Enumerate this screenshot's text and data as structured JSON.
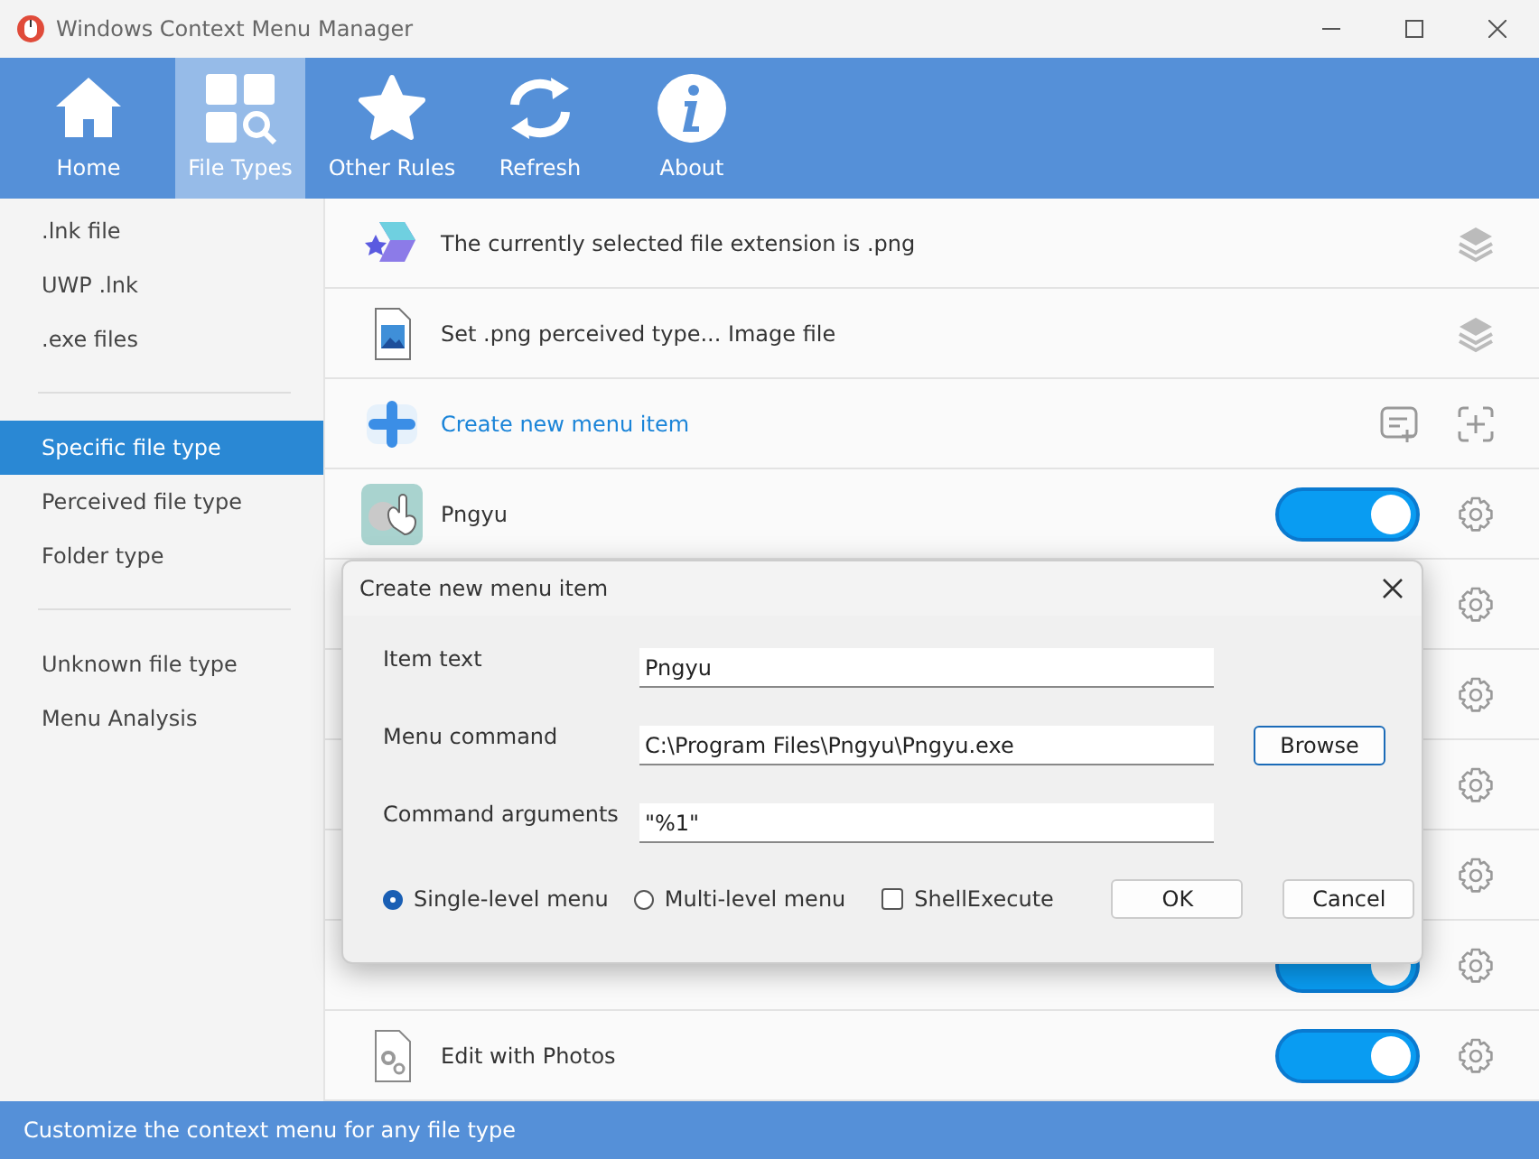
{
  "window": {
    "title": "Windows Context Menu Manager"
  },
  "toolbar": [
    {
      "label": "Home",
      "selected": false
    },
    {
      "label": "File Types",
      "selected": true
    },
    {
      "label": "Other Rules",
      "selected": false
    },
    {
      "label": "Refresh",
      "selected": false
    },
    {
      "label": "About",
      "selected": false
    }
  ],
  "sidebar": {
    "groups": [
      [
        {
          "label": ".lnk file",
          "selected": false
        },
        {
          "label": "UWP .lnk",
          "selected": false
        },
        {
          "label": ".exe files",
          "selected": false
        }
      ],
      [
        {
          "label": "Specific file type",
          "selected": true
        },
        {
          "label": "Perceived file type",
          "selected": false
        },
        {
          "label": "Folder type",
          "selected": false
        }
      ],
      [
        {
          "label": "Unknown file type",
          "selected": false
        },
        {
          "label": "Menu Analysis",
          "selected": false
        }
      ]
    ]
  },
  "rows": [
    {
      "kind": "info",
      "label": "The currently selected file extension is .png"
    },
    {
      "kind": "info",
      "label": "Set .png perceived type... Image file"
    },
    {
      "kind": "create",
      "label": "Create new menu item"
    },
    {
      "kind": "toggle",
      "label": "Pngyu",
      "on": true
    },
    {
      "kind": "gear"
    },
    {
      "kind": "gear"
    },
    {
      "kind": "gear"
    },
    {
      "kind": "gear"
    },
    {
      "kind": "toggle",
      "on": true
    },
    {
      "kind": "toggle",
      "label": "Edit with Photos",
      "on": true
    }
  ],
  "dialog": {
    "title": "Create new menu item",
    "fields": [
      {
        "label": "Item text",
        "value": "Pngyu"
      },
      {
        "label": "Menu command",
        "value": "C:\\Program Files\\Pngyu\\Pngyu.exe",
        "button": "Browse"
      },
      {
        "label": "Command arguments",
        "value": "\"%1\""
      }
    ],
    "options": [
      {
        "kind": "radio",
        "label": "Single-level menu",
        "checked": true
      },
      {
        "kind": "radio",
        "label": "Multi-level menu",
        "checked": false
      },
      {
        "kind": "checkbox",
        "label": "ShellExecute",
        "checked": false
      }
    ],
    "buttons": [
      "OK",
      "Cancel"
    ]
  },
  "status_bar": "Customize the context menu for any file type"
}
